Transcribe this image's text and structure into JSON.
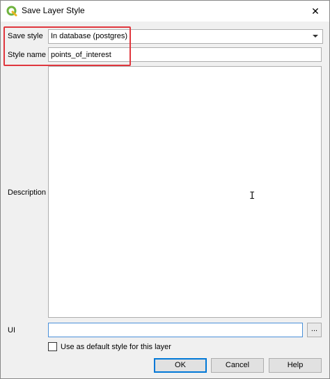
{
  "window": {
    "title": "Save Layer Style",
    "close_glyph": "✕",
    "app_icon": "qgis-logo-icon"
  },
  "form": {
    "save_style_label": "Save style",
    "save_style_value": "In database (postgres)",
    "style_name_label": "Style name",
    "style_name_value": "points_of_interest",
    "description_label": "Description",
    "description_value": "",
    "ui_label": "UI",
    "ui_value": "",
    "browse_label": "...",
    "default_checkbox_label": "Use as default style for this layer",
    "default_checkbox_checked": false
  },
  "buttons": {
    "ok": "OK",
    "cancel": "Cancel",
    "help": "Help"
  },
  "colors": {
    "highlight": "#e0363d",
    "focus": "#4a90d9",
    "qgis_green": "#6fb33f"
  }
}
